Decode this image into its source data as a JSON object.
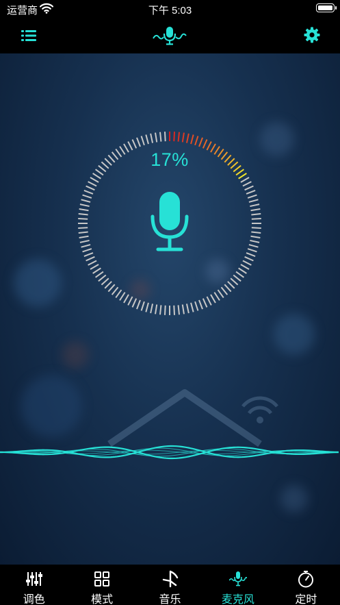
{
  "status_bar": {
    "carrier": "运营商",
    "time": "下午 5:03",
    "battery_level": 1.0
  },
  "nav": {
    "menu_icon": "list-icon",
    "logo_icon": "mic-wave-icon",
    "settings_icon": "gear-icon"
  },
  "mic": {
    "level_percent": "17%",
    "level_fraction": 0.17
  },
  "tabs": [
    {
      "label": "调色",
      "icon": "sliders-icon",
      "active": false
    },
    {
      "label": "模式",
      "icon": "grid-icon",
      "active": false
    },
    {
      "label": "音乐",
      "icon": "music-note-icon",
      "active": false
    },
    {
      "label": "麦克风",
      "icon": "mic-wave-icon",
      "active": true
    },
    {
      "label": "定时",
      "icon": "timer-icon",
      "active": false
    }
  ],
  "colors": {
    "accent": "#27e1d6",
    "bar_background": "#000000",
    "tick_idle": "#c8c8c8",
    "level_start": "#d81f1f",
    "level_mid": "#e8742a",
    "level_end": "#f2e62a"
  }
}
